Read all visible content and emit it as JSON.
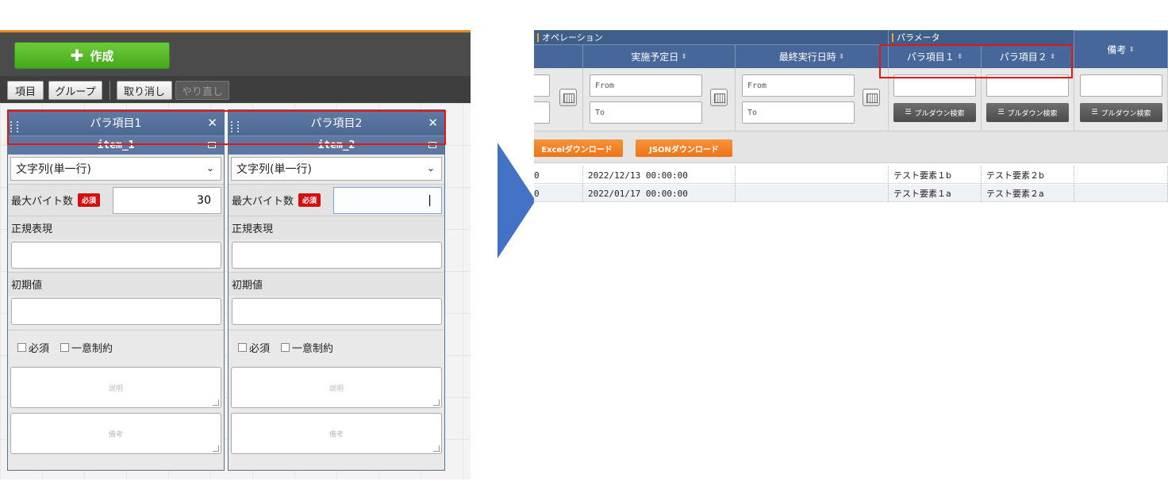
{
  "left_panel": {
    "create_button": {
      "label": "作成"
    },
    "toolbar": {
      "item": "項目",
      "group": "グループ",
      "undo": "取り消し",
      "redo": "やり直し"
    },
    "columns": [
      {
        "title": "パラ項目1",
        "key": "item_1",
        "type_select": "文字列(単一行)",
        "max_bytes_label": "最大バイト数",
        "required_badge": "必須",
        "max_bytes_value": "30",
        "regex_label": "正規表現",
        "default_label": "初期値",
        "required_chk": "必須",
        "unique_chk": "一意制約",
        "description_placeholder": "説明",
        "remarks_placeholder": "備考"
      },
      {
        "title": "パラ項目2",
        "key": "item_2",
        "type_select": "文字列(単一行)",
        "max_bytes_label": "最大バイト数",
        "required_badge": "必須",
        "max_bytes_value": "|",
        "regex_label": "正規表現",
        "default_label": "初期値",
        "required_chk": "必須",
        "unique_chk": "一意制約",
        "description_placeholder": "説明",
        "remarks_placeholder": "備考"
      }
    ]
  },
  "right_panel": {
    "group_headers": {
      "operation": "オペレーション",
      "parameter": "パラメータ"
    },
    "column_headers": {
      "scheduled_date": "実施予定日",
      "last_exec": "最終実行日時",
      "para1": "パラ項目１",
      "para2": "パラ項目２",
      "remarks": "備考"
    },
    "filters": {
      "from": "From",
      "to": "To",
      "pulldown": "プルダウン検索"
    },
    "downloads": {
      "excel": "Excelダウンロード",
      "json": "JSONダウンロード"
    },
    "rows": [
      {
        "idcut": "0",
        "scheduled": "2022/12/13 00:00:00",
        "last": "",
        "para1": "テスト要素１b",
        "para2": "テスト要素２b",
        "remarks": ""
      },
      {
        "idcut": "0",
        "scheduled": "2022/01/17 00:00:00",
        "last": "",
        "para1": "テスト要素１a",
        "para2": "テスト要素２a",
        "remarks": ""
      }
    ]
  },
  "colors": {
    "accent_green": "#43a81c",
    "header_blue": "#47679a",
    "highlight_red": "#e01818",
    "arrow_blue": "#4472c4",
    "download_orange": "#ee7415"
  }
}
